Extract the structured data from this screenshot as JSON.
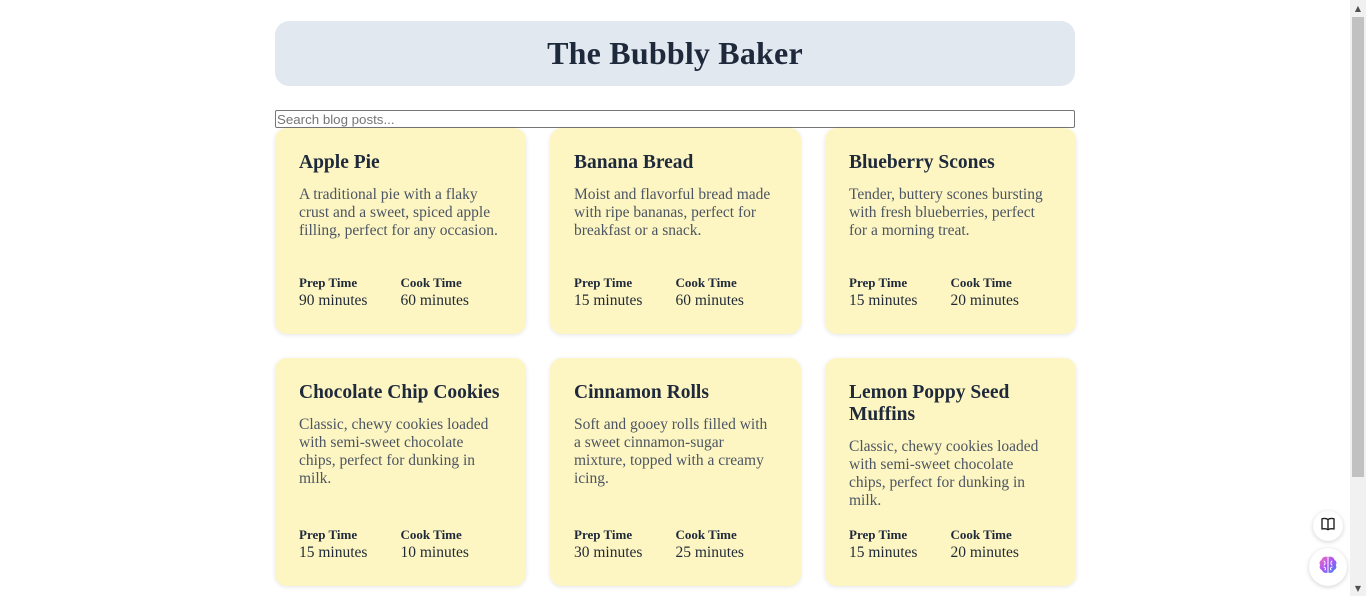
{
  "header": {
    "title": "The Bubbly Baker"
  },
  "search": {
    "placeholder": "Search blog posts...",
    "value": ""
  },
  "labels": {
    "prep": "Prep Time",
    "cook": "Cook Time"
  },
  "recipes": [
    {
      "title": "Apple Pie",
      "description": "A traditional pie with a flaky crust and a sweet, spiced apple filling, perfect for any occasion.",
      "prep": "90 minutes",
      "cook": "60 minutes"
    },
    {
      "title": "Banana Bread",
      "description": "Moist and flavorful bread made with ripe bananas, perfect for breakfast or a snack.",
      "prep": "15 minutes",
      "cook": "60 minutes"
    },
    {
      "title": "Blueberry Scones",
      "description": "Tender, buttery scones bursting with fresh blueberries, perfect for a morning treat.",
      "prep": "15 minutes",
      "cook": "20 minutes"
    },
    {
      "title": "Chocolate Chip Cookies",
      "description": "Classic, chewy cookies loaded with semi-sweet chocolate chips, perfect for dunking in milk.",
      "prep": "15 minutes",
      "cook": "10 minutes"
    },
    {
      "title": "Cinnamon Rolls",
      "description": "Soft and gooey rolls filled with a sweet cinnamon-sugar mixture, topped with a creamy icing.",
      "prep": "30 minutes",
      "cook": "25 minutes"
    },
    {
      "title": "Lemon Poppy Seed Muffins",
      "description": "Classic, chewy cookies loaded with semi-sweet chocolate chips, perfect for dunking in milk.",
      "prep": "15 minutes",
      "cook": "20 minutes"
    }
  ],
  "floating": {
    "top_icon": "book-icon",
    "bottom_icon": "brain-icon"
  },
  "colors": {
    "header_bg": "#e2e8f0",
    "card_bg": "#fef6c2",
    "text": "#1e293b"
  }
}
